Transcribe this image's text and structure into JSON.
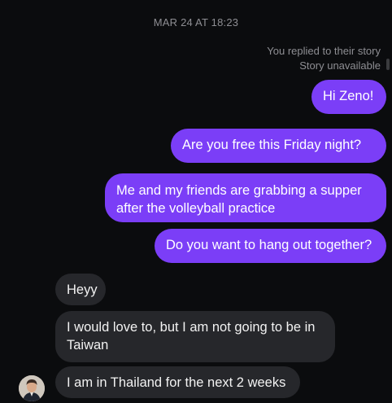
{
  "thread": {
    "timestamp": "MAR 24 AT 18:23",
    "story_reply_note": "You replied to their story",
    "story_status": "Story unavailable"
  },
  "messages": [
    {
      "from": "me",
      "text": "Hi Zeno!"
    },
    {
      "from": "me",
      "text": "Are you free this Friday night?"
    },
    {
      "from": "me",
      "text": "Me and my friends are grabbing a supper after the volleyball practice"
    },
    {
      "from": "me",
      "text": "Do you want to hang out together?"
    },
    {
      "from": "them",
      "text": "Heyy"
    },
    {
      "from": "them",
      "text": "I would love to, but I am not going to be in Taiwan"
    },
    {
      "from": "them",
      "text": "I am in Thailand for the next 2 weeks"
    }
  ],
  "colors": {
    "background": "#0b0c0e",
    "outgoing_bubble": "#7b3ef7",
    "incoming_bubble": "#26272b",
    "meta_text": "#8e8e93"
  },
  "icons": {
    "avatar": "contact-avatar"
  }
}
